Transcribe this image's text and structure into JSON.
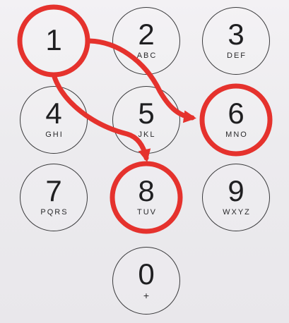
{
  "keypad": {
    "keys": [
      {
        "digit": "1",
        "letters": ""
      },
      {
        "digit": "2",
        "letters": "ABC"
      },
      {
        "digit": "3",
        "letters": "DEF"
      },
      {
        "digit": "4",
        "letters": "GHI"
      },
      {
        "digit": "5",
        "letters": "JKL"
      },
      {
        "digit": "6",
        "letters": "MNO"
      },
      {
        "digit": "7",
        "letters": "PQRS"
      },
      {
        "digit": "8",
        "letters": "TUV"
      },
      {
        "digit": "9",
        "letters": "WXYZ"
      },
      {
        "digit": "0",
        "letters": "+"
      }
    ]
  },
  "annotation": {
    "color": "#e5322d",
    "highlighted_keys": [
      "1",
      "6",
      "8"
    ],
    "arrows": [
      {
        "from": "1",
        "to": "6"
      },
      {
        "from": "1",
        "to": "8"
      }
    ]
  }
}
